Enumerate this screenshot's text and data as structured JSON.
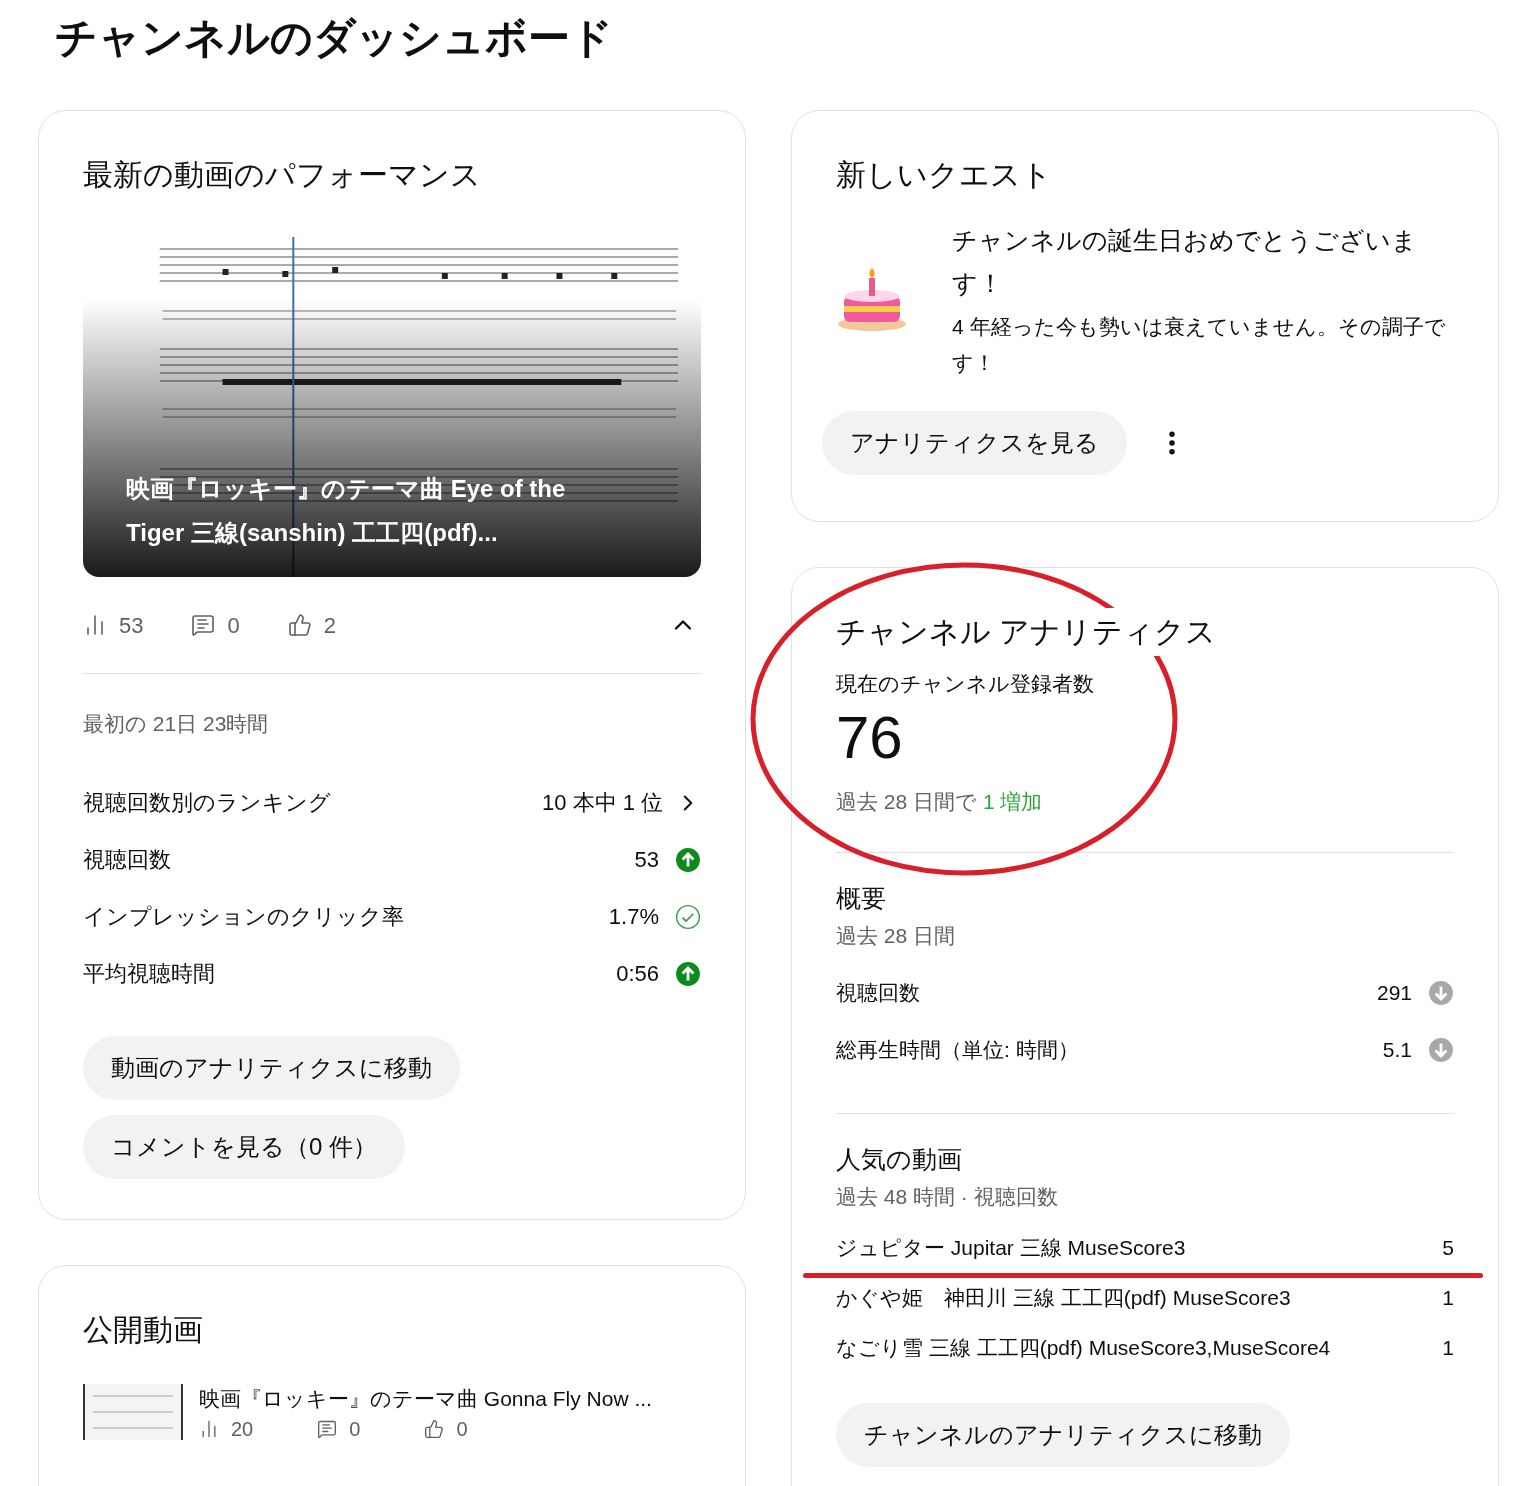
{
  "page_title": "チャンネルのダッシュボード",
  "latest_video": {
    "title": "最新の動画のパフォーマンス",
    "thumbnail": {
      "kind": "picture"
    },
    "video_title": "映画『ロッキー』のテーマ曲 Eye of the Tiger 三線(sanshin) 工工四(pdf)...",
    "stats": [
      {
        "kind": "views",
        "value": "53"
      },
      {
        "kind": "comments",
        "value": "0"
      },
      {
        "kind": "likes",
        "value": "2"
      }
    ],
    "expanded": true,
    "period": "最初の 21日 23時間",
    "ranking": {
      "label": "視聴回数別のランキング",
      "value": "10 本中 1 位"
    },
    "metrics": [
      {
        "label": "視聴回数",
        "value": "53",
        "kind": "up"
      },
      {
        "label": "インプレッションのクリック率",
        "value": "1.7%",
        "kind": "check"
      },
      {
        "label": "平均視聴時間",
        "value": "0:56",
        "kind": "up"
      }
    ],
    "buttons": [
      "動画のアナリティクスに移動",
      "コメントを見る（0 件）"
    ]
  },
  "quest": {
    "title": "新しいクエスト",
    "heading": "チャンネルの誕生日おめでとうございます！",
    "body": "4 年経った今も勢いは衰えていません。その調子です！",
    "button": "アナリティクスを見る"
  },
  "channel_analytics": {
    "title": "チャンネル アナリティクス",
    "subscribers_label": "現在のチャンネル登録者数",
    "subscribers": "76",
    "change_prefix": "過去 28 日間で",
    "change": "1 増加",
    "summary_title": "概要",
    "summary_period": "過去 28 日間",
    "metrics": [
      {
        "label": "視聴回数",
        "value": "291",
        "kind": "down"
      },
      {
        "label": "総再生時間（単位: 時間）",
        "value": "5.1",
        "kind": "down"
      }
    ],
    "popular_title": "人気の動画",
    "popular_period": "過去 48 時間 · 視聴回数",
    "videos": [
      {
        "title": "ジュピター Jupitar 三線 MuseScore3",
        "views": "5"
      },
      {
        "title": "かぐや姫　神田川 三線 工工四(pdf) MuseScore3",
        "views": "1"
      },
      {
        "title": "なごり雪 三線 工工四(pdf) MuseScore3,MuseScore4",
        "views": "1"
      }
    ],
    "button": "チャンネルのアナリティクスに移動"
  },
  "published": {
    "title": "公開動画",
    "videos": [
      {
        "title": "映画『ロッキー』のテーマ曲 Gonna Fly Now ...",
        "stats": [
          {
            "kind": "views",
            "value": "20"
          },
          {
            "kind": "comments",
            "value": "0"
          },
          {
            "kind": "likes",
            "value": "0"
          }
        ]
      }
    ]
  }
}
